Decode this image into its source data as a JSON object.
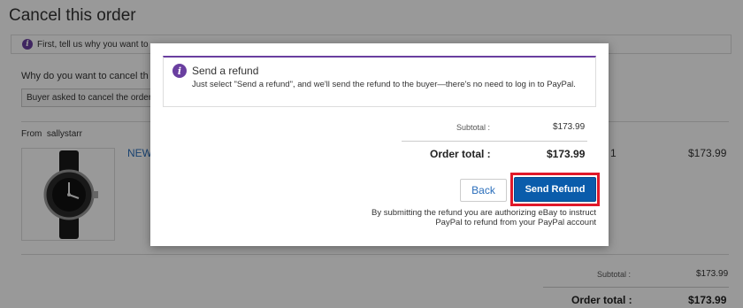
{
  "page": {
    "title": "Cancel this order",
    "info_text": "First, tell us why you want to",
    "question": "Why do you want to cancel th",
    "reason_selected": "Buyer asked to cancel the order",
    "from_label": "From",
    "seller": "sallystarr",
    "item_link": "NEW",
    "item_qty": "1",
    "item_price": "$173.99",
    "subtotal_label": "Subtotal :",
    "subtotal_value": "$173.99",
    "order_total_label": "Order total :",
    "order_total_value": "$173.99"
  },
  "modal": {
    "alert_title": "Send a refund",
    "alert_body": "Just select \"Send a refund\", and we'll send the refund to the buyer—there's no need to log in to PayPal.",
    "subtotal_label": "Subtotal :",
    "subtotal_value": "$173.99",
    "order_total_label": "Order total :",
    "order_total_value": "$173.99",
    "back_label": "Back",
    "send_label": "Send Refund",
    "disclaimer": "By submitting the refund you are authorizing eBay to instruct PayPal to refund from your PayPal account"
  },
  "colors": {
    "accent": "#6a3fa0",
    "primary_button": "#0a5cab",
    "highlight": "#e0192a",
    "link": "#2a6ebb"
  }
}
